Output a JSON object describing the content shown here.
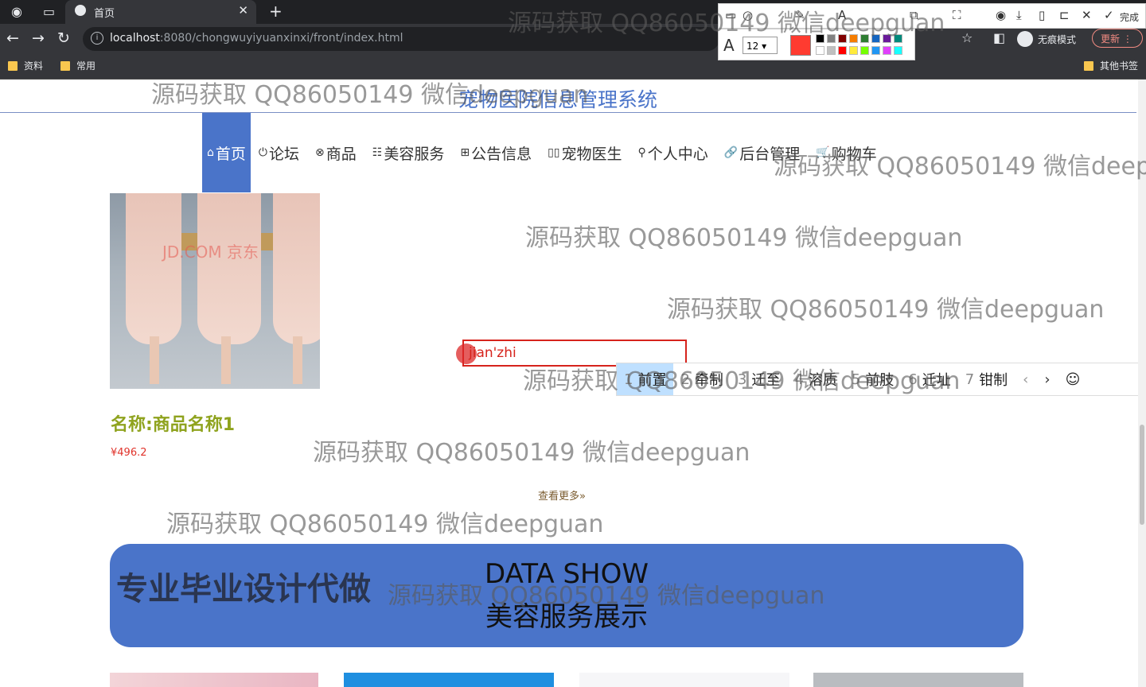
{
  "browser": {
    "tab_title": "首页",
    "url_host": "localhost",
    "url_rest": ":8080/chongwuyiyuanxinxi/front/index.html",
    "incognito_label": "无痕模式",
    "update_label": "更新",
    "bookmarks": [
      "资料",
      "常用"
    ],
    "other_bookmarks": "其他书签",
    "annot_done": "完成",
    "annot_font_size": "12"
  },
  "site": {
    "title": "宠物医院信息管理系统",
    "menu": [
      {
        "icon": "home-icon",
        "glyph": "⌂",
        "label": "首页"
      },
      {
        "icon": "forum-icon",
        "glyph": "⏻",
        "label": "论坛"
      },
      {
        "icon": "goods-icon",
        "glyph": "⊗",
        "label": "商品"
      },
      {
        "icon": "beauty-icon",
        "glyph": "☷",
        "label": "美容服务"
      },
      {
        "icon": "notice-icon",
        "glyph": "⊞",
        "label": "公告信息"
      },
      {
        "icon": "doctor-icon",
        "glyph": "▯▯",
        "label": "宠物医生"
      },
      {
        "icon": "user-icon",
        "glyph": "⚲",
        "label": "个人中心"
      },
      {
        "icon": "admin-icon",
        "glyph": "🔗",
        "label": "后台管理"
      },
      {
        "icon": "cart-icon",
        "glyph": "🛒",
        "label": "购物车"
      }
    ]
  },
  "product": {
    "name": "名称:商品名称1",
    "price": "¥496.2",
    "more": "查看更多»",
    "image_watermark": "JD.COM 京东"
  },
  "banner": {
    "ad_text": "专业毕业设计代做",
    "en": "DATA SHOW",
    "zh": "美容服务展示"
  },
  "ime": {
    "composition": "jian'zhi",
    "candidates": [
      {
        "n": "1",
        "w": "前置"
      },
      {
        "n": "2",
        "w": "牵制"
      },
      {
        "n": "3",
        "w": "迁至"
      },
      {
        "n": "4",
        "w": "溶质"
      },
      {
        "n": "5",
        "w": "前肢"
      },
      {
        "n": "6",
        "w": "迁址"
      },
      {
        "n": "7",
        "w": "钳制"
      }
    ]
  },
  "watermark": "源码获取 QQ86050149 微信deepguan",
  "colors": {
    "accent": "#4a74c9",
    "price": "#e0332b",
    "name": "#8fa31e"
  }
}
